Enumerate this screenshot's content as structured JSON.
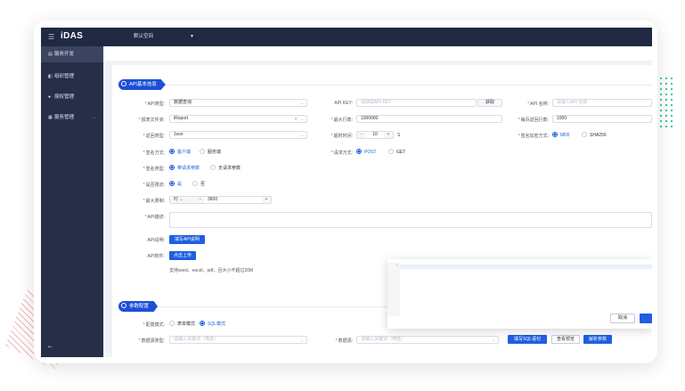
{
  "app": {
    "name": "iDAS",
    "workspace": "默认空间"
  },
  "sidebar": {
    "items": [
      {
        "label": "服务开发",
        "icon": "doc-icon"
      },
      {
        "label": "组织管理",
        "icon": "org-icon"
      },
      {
        "label": "授权管理",
        "icon": "user-icon"
      },
      {
        "label": "服务管理",
        "icon": "grid-icon"
      }
    ]
  },
  "section1": {
    "title": "API基本信息"
  },
  "form": {
    "api_type": {
      "label": "API类型:",
      "value": "数据查询"
    },
    "api_key": {
      "label": "API KEY:",
      "placeholder": "请获取API KEY",
      "button": "获取"
    },
    "api_name": {
      "label": "API 名称:",
      "placeholder": "请输入API 名称"
    },
    "report_file": {
      "label": "报表文件夹:",
      "value": "iReport"
    },
    "max_rows": {
      "label": "最大行数:",
      "value": "1000000"
    },
    "page_rows": {
      "label": "每页返回行数:",
      "value": "1000"
    },
    "return_type": {
      "label": "返回类型:",
      "value": "Json"
    },
    "timeout": {
      "label": "超时时间:",
      "value": "10",
      "unit": "S"
    },
    "sign_encrypt": {
      "label": "签名加密方式:",
      "options": [
        "MD5",
        "SHA256"
      ],
      "selected": "MD5"
    },
    "sign_mode": {
      "label": "签名方式:",
      "options": [
        "客户端",
        "服务端"
      ],
      "selected": "客户端"
    },
    "request_method": {
      "label": "请求方式:",
      "options": [
        "POST",
        "GET"
      ],
      "selected": "POST"
    },
    "sign_type": {
      "label": "签名类型:",
      "options": [
        "带请求参数",
        "无请求参数"
      ],
      "selected": "带请求参数"
    },
    "rate_limit": {
      "label": "是否限流:",
      "options": [
        "是",
        "否"
      ],
      "selected": "是"
    },
    "max_limit": {
      "label": "最大限制:",
      "unit": "时",
      "value": "3600"
    },
    "api_desc": {
      "label": "API描述:"
    },
    "api_doc": {
      "label": "API说明:",
      "button": "填写API说明"
    },
    "api_attach": {
      "label": "API附件:",
      "button": "点击上传",
      "note": "支持word、excel、pdf，且大小不超过20M"
    }
  },
  "section2": {
    "title": "参数配置"
  },
  "params": {
    "config_mode": {
      "label": "配置模式:",
      "options": [
        "表单模式",
        "SQL模式"
      ],
      "selected": "SQL模式"
    },
    "source_type": {
      "label": "数据源类型:",
      "placeholder": "请输入关键词（筛选）"
    },
    "datasource": {
      "label": "数据源:",
      "placeholder": "请输入关键词（筛选）"
    },
    "buttons": [
      "填写SQL语句",
      "查看预览",
      "解析参数"
    ]
  },
  "popup": {
    "cancel": "取消",
    "line": "1"
  }
}
